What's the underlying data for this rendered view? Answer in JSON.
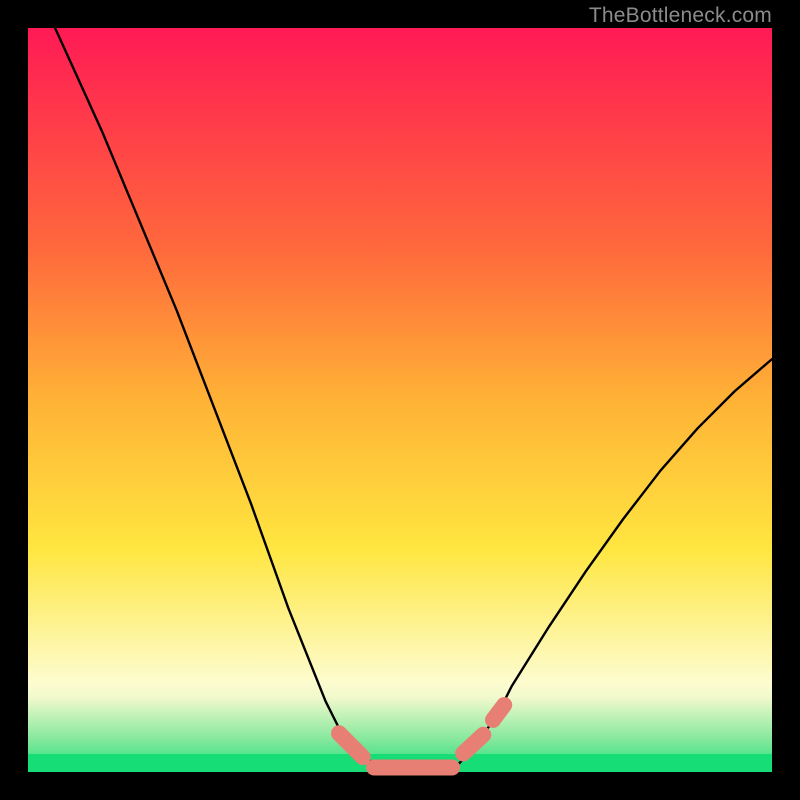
{
  "watermark": {
    "text": "TheBottleneck.com"
  },
  "colors": {
    "background": "#000000",
    "curve": "#000000",
    "marker_fill": "#e77f75",
    "marker_stroke": "#e77f75",
    "gradient_top": "#ff1a55",
    "gradient_bottom": "#1ee07a"
  },
  "chart_data": {
    "type": "line",
    "title": "",
    "xlabel": "",
    "ylabel": "",
    "x": [
      0.0,
      0.05,
      0.1,
      0.15,
      0.2,
      0.25,
      0.3,
      0.35,
      0.4,
      0.42,
      0.45,
      0.48,
      0.5,
      0.53,
      0.55,
      0.58,
      0.6,
      0.63,
      0.65,
      0.7,
      0.75,
      0.8,
      0.85,
      0.9,
      0.95,
      1.0
    ],
    "series": [
      {
        "name": "curve",
        "values": [
          1.08,
          0.97,
          0.86,
          0.74,
          0.62,
          0.49,
          0.36,
          0.22,
          0.095,
          0.055,
          0.02,
          0.004,
          0.0,
          0.0,
          0.003,
          0.012,
          0.035,
          0.075,
          0.115,
          0.195,
          0.27,
          0.34,
          0.405,
          0.462,
          0.512,
          0.555
        ]
      }
    ],
    "xlim": [
      0,
      1
    ],
    "ylim": [
      0,
      1
    ],
    "grid": false,
    "legend": false,
    "markers": {
      "segments": [
        {
          "x0": 0.418,
          "x1": 0.45,
          "y0": 0.052,
          "y1": 0.02
        },
        {
          "x0": 0.465,
          "x1": 0.57,
          "y0": 0.006,
          "y1": 0.006
        },
        {
          "x0": 0.585,
          "x1": 0.612,
          "y0": 0.025,
          "y1": 0.05
        },
        {
          "x0": 0.625,
          "x1": 0.64,
          "y0": 0.07,
          "y1": 0.09
        }
      ],
      "stroke_width_px": 16
    },
    "note": "Axes are normalized 0–1; no numeric tick labels are shown in the source image. Values are estimated from pixel positions against the plot bounds."
  }
}
